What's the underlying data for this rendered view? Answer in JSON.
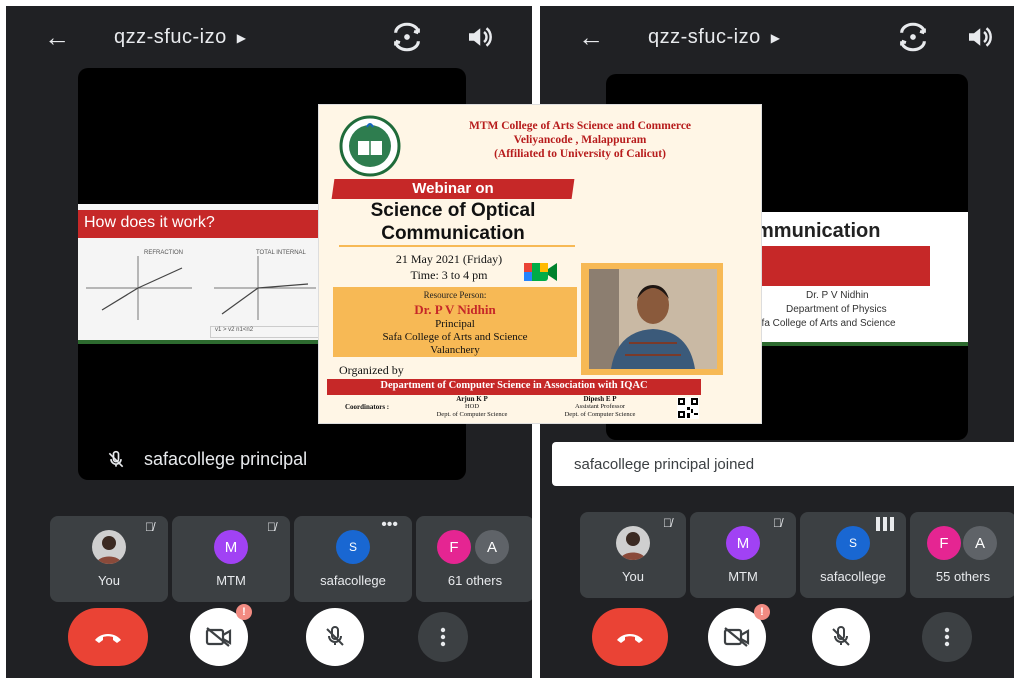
{
  "left": {
    "meeting_code": "qzz-sfuc-izo",
    "slide": {
      "title": "How does it work?",
      "label_a": "REFRACTION",
      "label_b": "TOTAL INTERNAL",
      "note": "v1 > v2  n1<n2"
    },
    "presenter_name": "safacollege principal",
    "participants": [
      {
        "label": "You",
        "initial": "",
        "color": "#5f6368"
      },
      {
        "label": "MTM",
        "initial": "M",
        "color": "#a142f4"
      },
      {
        "label": "safacollege",
        "initial": "S",
        "color": "#1967d2"
      }
    ],
    "others": {
      "label": "61 others",
      "initials": [
        "F",
        "A"
      ],
      "colors": [
        "#e52592",
        "#5f6368"
      ]
    }
  },
  "right": {
    "meeting_code": "qzz-sfuc-izo",
    "slide": {
      "heading": "mmunication",
      "name": "Dr. P V Nidhin",
      "dept": "Department of Physics",
      "college": "afa College of Arts and Science"
    },
    "toast": "safacollege principal joined",
    "participants": [
      {
        "label": "You",
        "initial": "",
        "color": "#5f6368"
      },
      {
        "label": "MTM",
        "initial": "M",
        "color": "#a142f4"
      },
      {
        "label": "safacollege",
        "initial": "S",
        "color": "#1967d2"
      }
    ],
    "others": {
      "label": "55 others",
      "initials": [
        "F",
        "A"
      ],
      "colors": [
        "#e52592",
        "#5f6368"
      ]
    }
  },
  "poster": {
    "college": "MTM College of Arts Science and Commerce",
    "place": "Veliyancode , Malappuram",
    "affiliation": "(Affiliated to University of Calicut)",
    "banner": "Webinar on",
    "title_1": "Science of Optical",
    "title_2": "Communication",
    "date": "21 May  2021 (Friday)",
    "time": "Time: 3 to 4 pm",
    "resource_label": "Resource Person:",
    "speaker": "Dr. P V Nidhin",
    "role": "Principal",
    "institution": "Safa College of Arts and Science",
    "city": "Valanchery",
    "organized_by": "Organized by",
    "department": "Department of Computer Science in Association with IQAC",
    "coordinators_label": "Coordinators :",
    "coord1_name": "Arjun K P",
    "coord1_role": "HOD",
    "coord1_dept": "Dept. of Computer Science",
    "coord2_name": "Dipesh E P",
    "coord2_role": "Assistant Professor",
    "coord2_dept": "Dept. of Computer Science"
  },
  "colors": {
    "bg": "#202124",
    "tile": "#3c4043",
    "end_call": "#ea4335",
    "poster_red": "#c62828",
    "poster_orange": "#f7b955"
  }
}
